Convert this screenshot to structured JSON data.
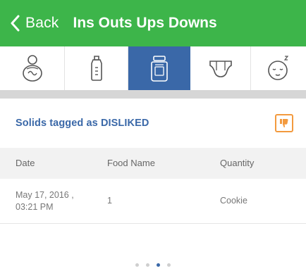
{
  "header": {
    "back_label": "Back",
    "title": "Ins Outs Ups Downs"
  },
  "tabs": [
    {
      "icon": "baby-icon",
      "active": false
    },
    {
      "icon": "bottle-icon",
      "active": false
    },
    {
      "icon": "food-jar-icon",
      "active": true
    },
    {
      "icon": "diaper-icon",
      "active": false
    },
    {
      "icon": "sleep-icon",
      "active": false
    }
  ],
  "section": {
    "title": "Solids tagged as DISLIKED",
    "action_icon": "thumbs-down-icon"
  },
  "table": {
    "columns": [
      "Date",
      "Food Name",
      "Quantity"
    ],
    "rows": [
      {
        "date": "May 17, 2016 ,\n03:21 PM",
        "food_name": "1",
        "quantity": "Cookie"
      }
    ]
  },
  "pagination": {
    "count": 4,
    "active_index": 2
  },
  "colors": {
    "header_green": "#3db54a",
    "accent_blue": "#3a68a8",
    "dislike_orange": "#f39a3e"
  }
}
